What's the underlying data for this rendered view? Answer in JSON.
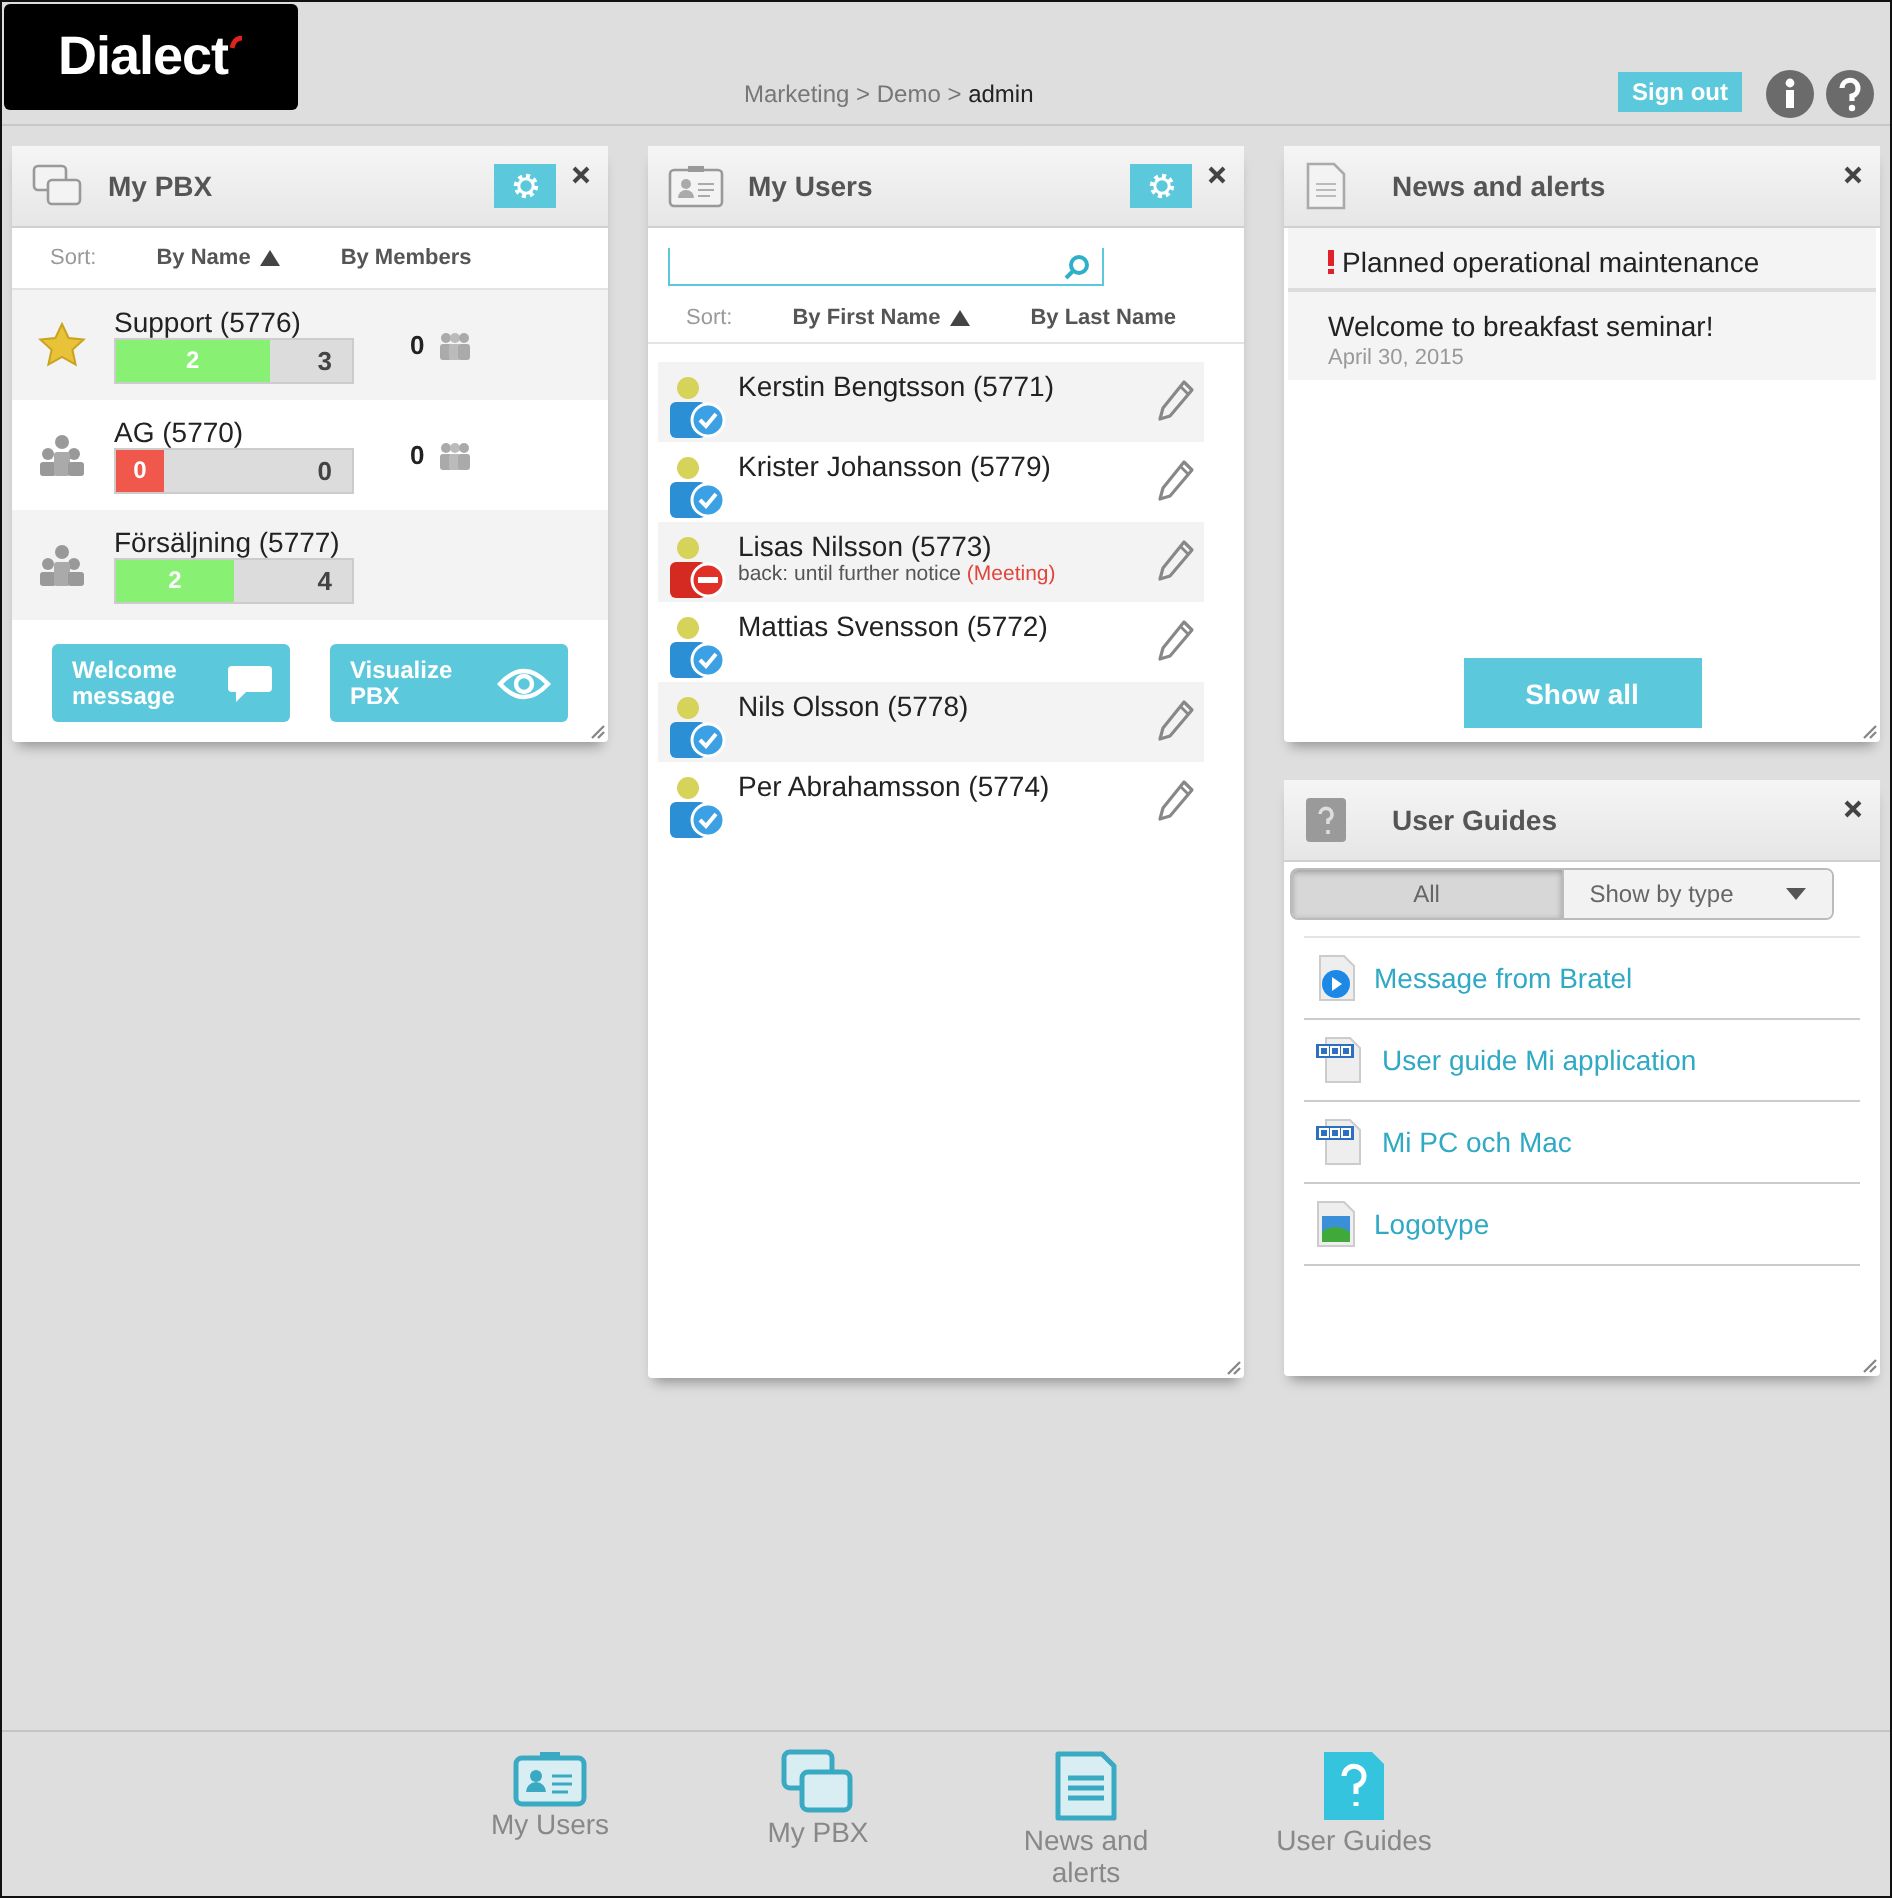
{
  "logo": {
    "text": "Dialect"
  },
  "breadcrumb": "Marketing > Demo > **admin**",
  "header_buttons": {
    "sign_out": "Sign out"
  },
  "pbx_panel": {
    "title": "My PBX",
    "sort_label": "Sort:",
    "sort_options": [
      {
        "label": "By Name",
        "selected": true
      },
      {
        "label": "By Members",
        "selected": false
      }
    ],
    "groups": [
      {
        "name": "Support (5776)",
        "favorite": true,
        "level": 0.65,
        "logged_in": "2",
        "total": "3",
        "queue": "0"
      },
      {
        "name": "AG (5770)",
        "favorite": false,
        "level": 0,
        "logged_in": "0",
        "total": "0",
        "queue": "0"
      },
      {
        "name": "Försäljning (5777)",
        "favorite": false,
        "level": 0.5,
        "logged_in": "2",
        "total": "4"
      }
    ],
    "buttons": [
      {
        "label": "Welcome message",
        "kind": "message"
      },
      {
        "label": "Visualize PBX",
        "kind": "view"
      }
    ]
  },
  "users_panel": {
    "title": "My Users",
    "sort_label": "Sort:",
    "sort_options": [
      {
        "label": "By First Name",
        "selected": true
      },
      {
        "label": "By Last Name",
        "selected": false
      }
    ],
    "users": [
      {
        "name": "Kerstin Bengtsson (5771)",
        "busy": false
      },
      {
        "name": "Krister Johansson (5779)",
        "busy": false
      },
      {
        "name": "Lisas Nilsson (5773)",
        "busy": true,
        "note": "back: until further notice",
        "reason": "(Meeting)"
      },
      {
        "name": "Mattias Svensson (5772)",
        "busy": false
      },
      {
        "name": "Nils Olsson (5778)",
        "busy": false
      },
      {
        "name": "Per Abrahamsson (5774)",
        "busy": false
      }
    ]
  },
  "news_panel": {
    "title": "News and alerts",
    "items": [
      {
        "title": "Planned operational maintenance",
        "alert": true
      },
      {
        "title": "Welcome to breakfast seminar!",
        "alert": false,
        "date": "April 30, 2015"
      }
    ],
    "show_all": "Show all"
  },
  "guides_panel": {
    "title": "User Guides",
    "filters": [
      {
        "label": "All",
        "selected": true
      },
      {
        "label": "Show by type",
        "selected": false
      }
    ],
    "guides": [
      {
        "title": "Message from Bratel",
        "kind": "video"
      },
      {
        "title": "User guide Mi application",
        "kind": "doc"
      },
      {
        "title": "Mi PC och Mac",
        "kind": "doc"
      },
      {
        "title": "Logotype",
        "kind": "image"
      }
    ]
  },
  "dock": [
    {
      "label": "My Users",
      "kind": "users"
    },
    {
      "label": "My PBX",
      "kind": "pbx"
    },
    {
      "label": "News and alerts",
      "kind": "news"
    },
    {
      "label": "User Guides",
      "kind": "guides"
    }
  ]
}
